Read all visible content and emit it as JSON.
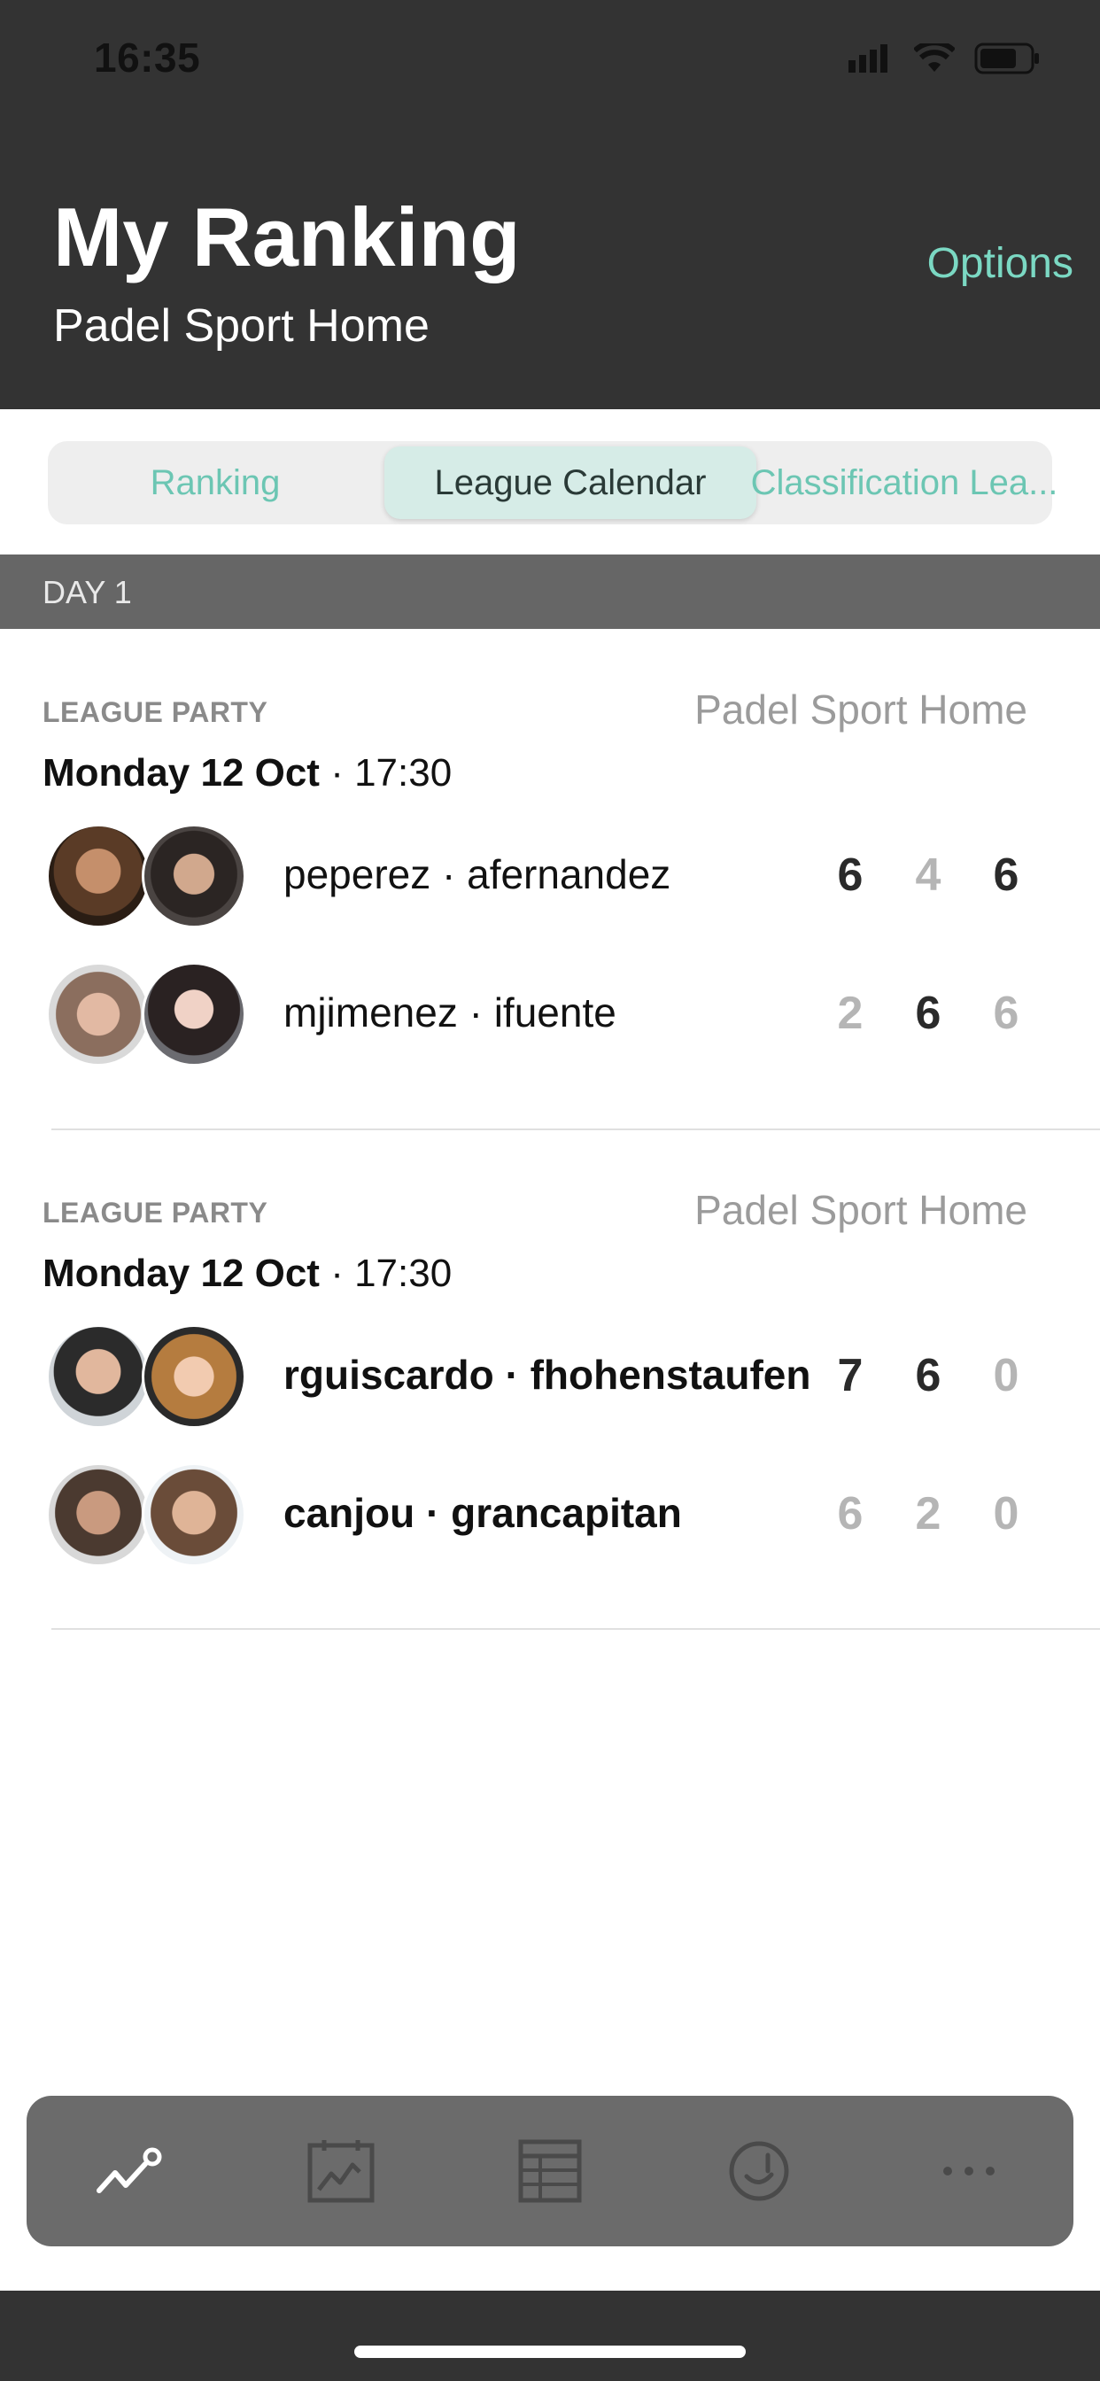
{
  "status": {
    "time": "16:35"
  },
  "header": {
    "title": "My Ranking",
    "subtitle": "Padel Sport Home",
    "options_label": "Options"
  },
  "tabs": [
    {
      "label": "Ranking",
      "active": false
    },
    {
      "label": "League Calendar",
      "active": true
    },
    {
      "label": "Classification Lea...",
      "active": false
    }
  ],
  "day": {
    "label": "DAY 1"
  },
  "matches": [
    {
      "type": "LEAGUE PARTY",
      "venue": "Padel Sport Home",
      "date_bold": "Monday 12 Oct",
      "time": " · 17:30",
      "teams": [
        {
          "names": "peperez · afernandez",
          "bold": false,
          "scores": [
            "6",
            "4",
            "6"
          ],
          "score_emphasis": [
            true,
            false,
            true
          ]
        },
        {
          "names": "mjimenez · ifuente",
          "bold": false,
          "scores": [
            "2",
            "6",
            "6"
          ],
          "score_emphasis": [
            false,
            true,
            false
          ]
        }
      ]
    },
    {
      "type": "LEAGUE PARTY",
      "venue": "Padel Sport Home",
      "date_bold": "Monday 12 Oct",
      "time": " · 17:30",
      "teams": [
        {
          "names": "rguiscardo · fhohenstaufen",
          "bold": true,
          "scores": [
            "7",
            "6",
            "0"
          ],
          "score_emphasis": [
            true,
            true,
            false
          ]
        },
        {
          "names": "canjou · grancapitan",
          "bold": true,
          "scores": [
            "6",
            "2",
            "0"
          ],
          "score_emphasis": [
            false,
            false,
            false
          ]
        }
      ]
    }
  ],
  "tabbar": {
    "items": [
      {
        "icon": "ranking-chart-icon",
        "active": true
      },
      {
        "icon": "calendar-chart-icon",
        "active": false
      },
      {
        "icon": "table-icon",
        "active": false
      },
      {
        "icon": "smiley-icon",
        "active": false
      },
      {
        "icon": "more-icon",
        "active": false
      }
    ]
  },
  "colors": {
    "accent": "#7bd8c3",
    "header_bg": "#333333",
    "tabbar_bg": "#6b6b6b",
    "score_strong": "#2a2a2a",
    "score_muted": "#b5b5b5"
  }
}
